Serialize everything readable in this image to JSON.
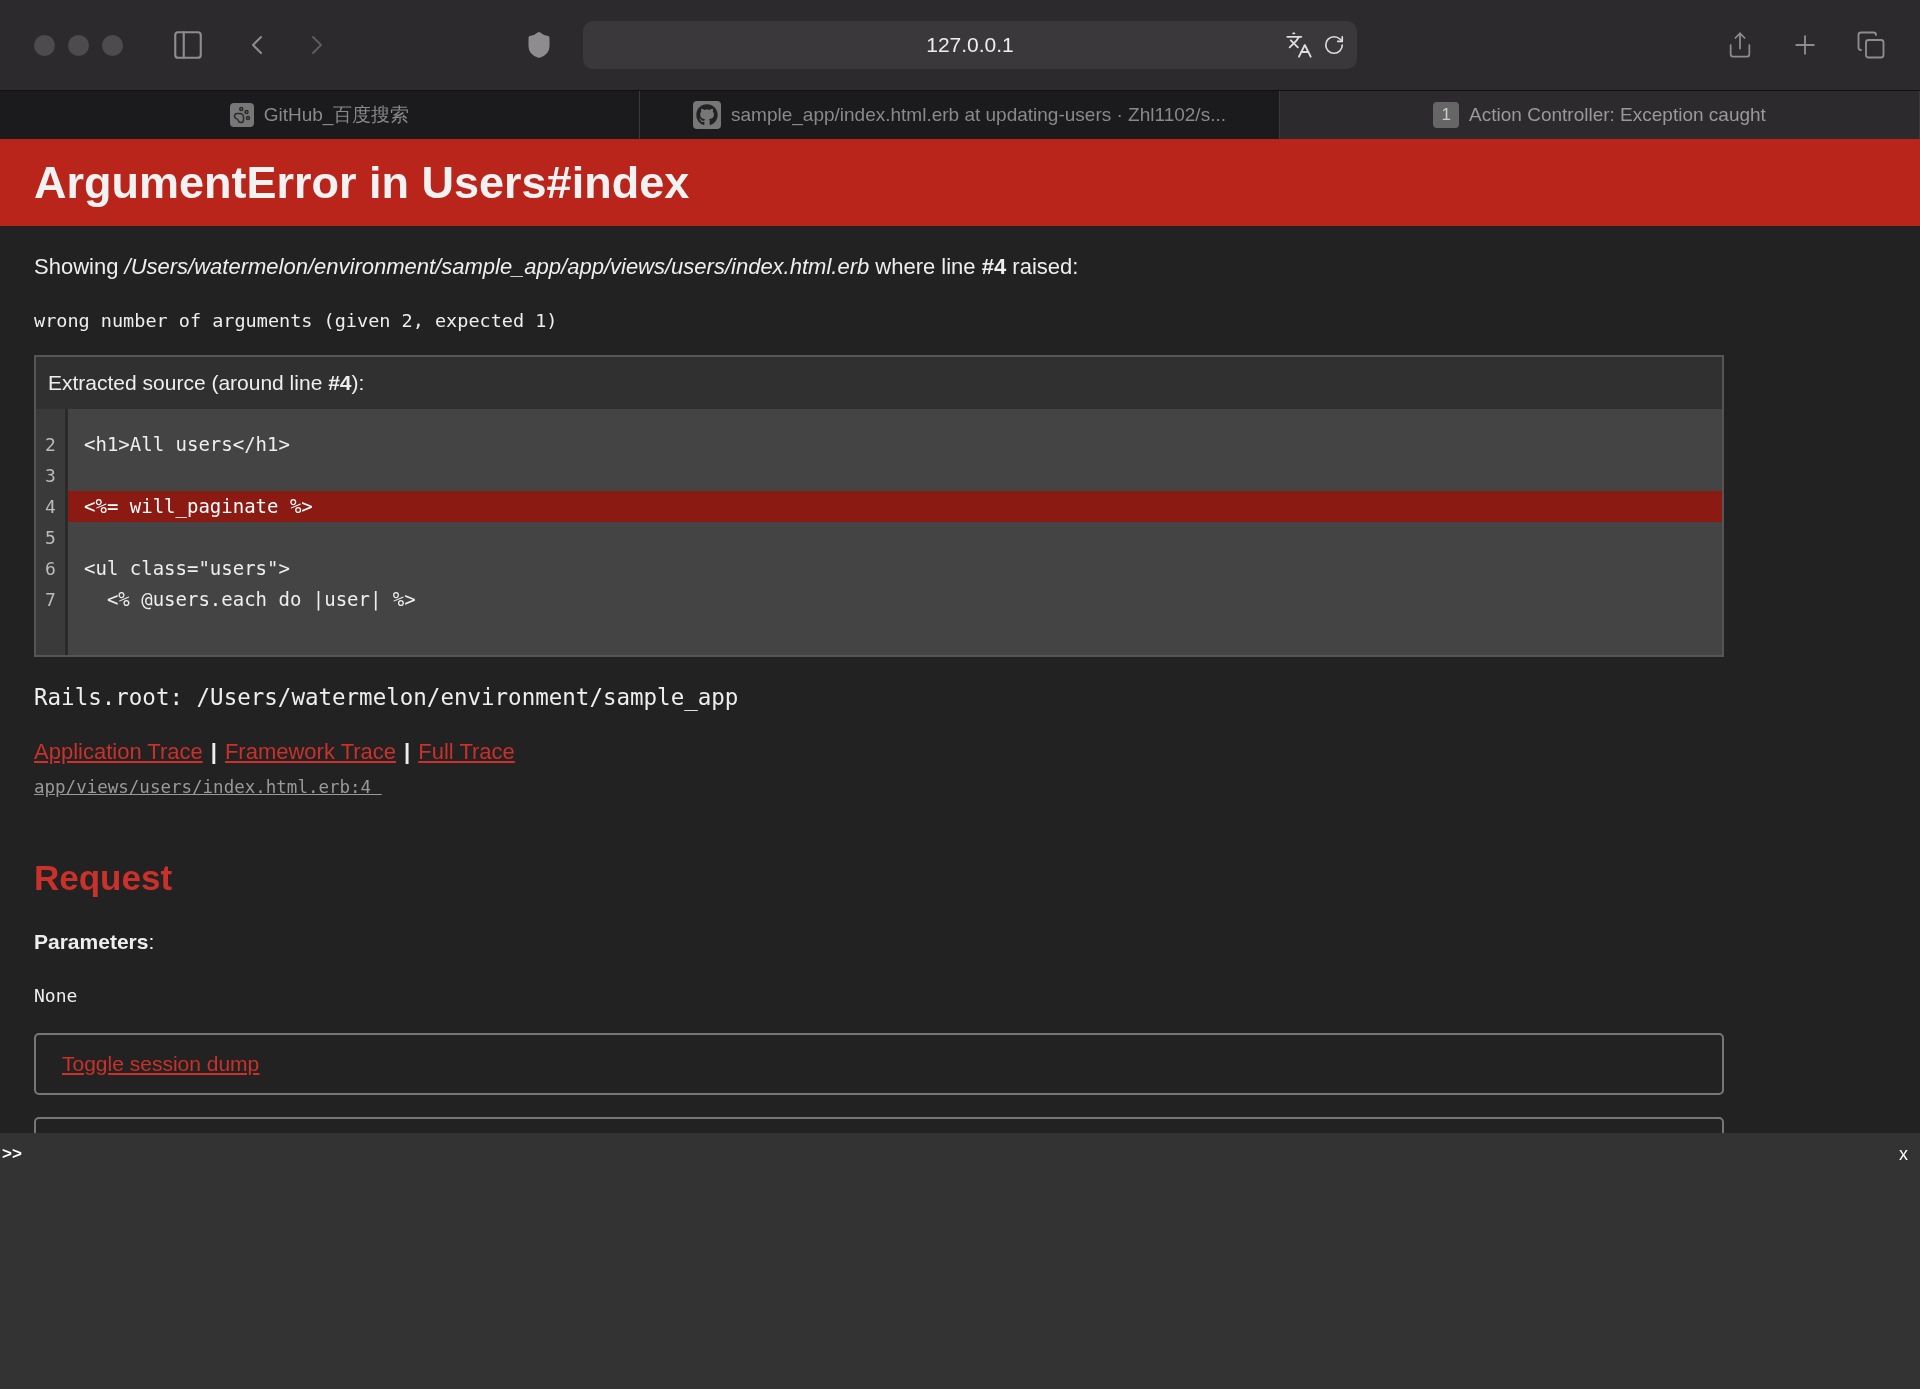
{
  "browser": {
    "url": "127.0.0.1",
    "tabs": [
      {
        "title": "GitHub_百度搜索",
        "kind": "paw",
        "selected": false
      },
      {
        "title": "sample_app/index.html.erb at updating-users · Zhl1102/s...",
        "kind": "cat",
        "selected": false
      },
      {
        "title": "Action Controller: Exception caught",
        "kind": "badge",
        "badge": "1",
        "selected": true
      }
    ]
  },
  "page": {
    "title": "ArgumentError in Users#index",
    "showing": "Showing */Users/watermelon/environment/sample_app/app/views/users/index.html.erb* where line **#4** raised:",
    "message": "wrong number of arguments (given 2, expected 1)",
    "source": {
      "title": "Extracted source (around line **#4**):",
      "lines": [
        {
          "number": "2",
          "code": "<h1>All users</h1>",
          "highlighted": false
        },
        {
          "number": "3",
          "highlighted": false
        },
        {
          "number": "4",
          "code": "<%= will_paginate %>",
          "highlighted": true
        },
        {
          "number": "5",
          "highlighted": false
        },
        {
          "number": "6",
          "code": "<ul class=\"users\">",
          "highlighted": false
        },
        {
          "number": "7",
          "code": "  <% @users.each do |user| %>",
          "highlighted": false
        }
      ]
    },
    "rails_root": "Rails.root: /Users/watermelon/environment/sample_app",
    "trace_links": [
      {
        "kind": "link",
        "text": "Application Trace"
      },
      {
        "kind": "separator",
        "text": "|"
      },
      {
        "kind": "link",
        "text": "Framework Trace"
      },
      {
        "kind": "separator",
        "text": "|"
      },
      {
        "kind": "link",
        "text": "Full Trace"
      }
    ],
    "trace_entry": "app/views/users/index.html.erb:4 ",
    "request_heading": "Request",
    "parameters_label": "**Parameters**:",
    "parameters_value": "None",
    "session_toggle": "Toggle session dump"
  },
  "console": {
    "prompt": ">>",
    "close": "x"
  }
}
